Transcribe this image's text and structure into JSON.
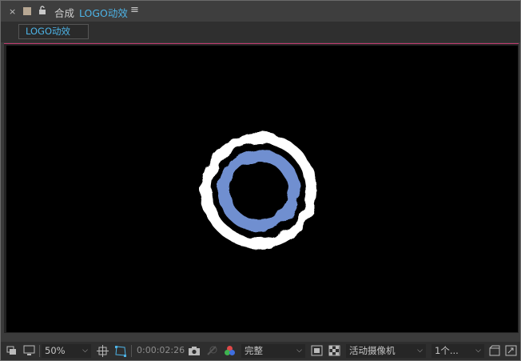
{
  "panel": {
    "close_glyph": "×",
    "label": "合成",
    "composition_name": "LOGO动效",
    "menu_glyph": "≡"
  },
  "tabs": [
    {
      "label": "LOGO动效",
      "active": true
    }
  ],
  "viewer": {
    "background": "#000000",
    "outer_ring_color": "#ffffff",
    "inner_ring_color": "#6f8fd0"
  },
  "toolbar": {
    "zoom": "50%",
    "timecode": "0:00:02:26",
    "resolution": "完整",
    "camera": "活动摄像机",
    "views": "1个..."
  },
  "colors": {
    "accent": "#4db3e6",
    "viewer_border": "#c13a6e"
  }
}
